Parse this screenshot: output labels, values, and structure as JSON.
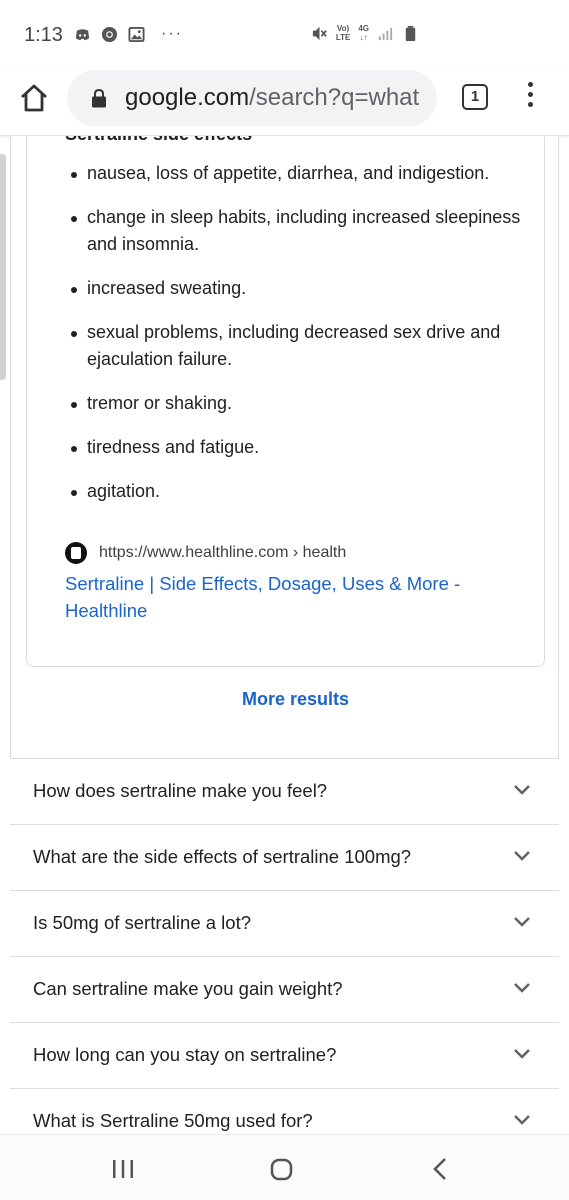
{
  "status_bar": {
    "time": "1:13",
    "left_icons": [
      "discord-icon",
      "chrome-icon",
      "gallery-icon"
    ],
    "more": "···",
    "volte": "Vo)) LTE",
    "network": "4G",
    "right_icons": [
      "mute-icon",
      "volte-icon",
      "4g-icon",
      "signal-icon",
      "battery-icon"
    ]
  },
  "browser": {
    "url_domain": "google.com",
    "url_path": "/search?q=what",
    "tab_count": "1"
  },
  "card": {
    "title": "Sertraline side effects",
    "items": [
      "nausea, loss of appetite, diarrhea, and indigestion.",
      "change in sleep habits, including increased sleepiness and insomnia.",
      "increased sweating.",
      "sexual problems, including decreased sex drive and ejaculation failure.",
      "tremor or shaking.",
      "tiredness and fatigue.",
      "agitation."
    ],
    "source_url": "https://www.healthline.com › health",
    "source_title": "Sertraline | Side Effects, Dosage, Uses & More - Healthline"
  },
  "more_results": "More results",
  "faqs": [
    "How does sertraline make you feel?",
    "What are the side effects of sertraline 100mg?",
    "Is 50mg of sertraline a lot?",
    "Can sertraline make you gain weight?",
    "How long can you stay on sertraline?",
    "What is Sertraline 50mg used for?"
  ],
  "colors": {
    "link": "#1a65c7",
    "text": "#202124",
    "border": "#dadce0",
    "omnibox": "#f1f3f4"
  }
}
